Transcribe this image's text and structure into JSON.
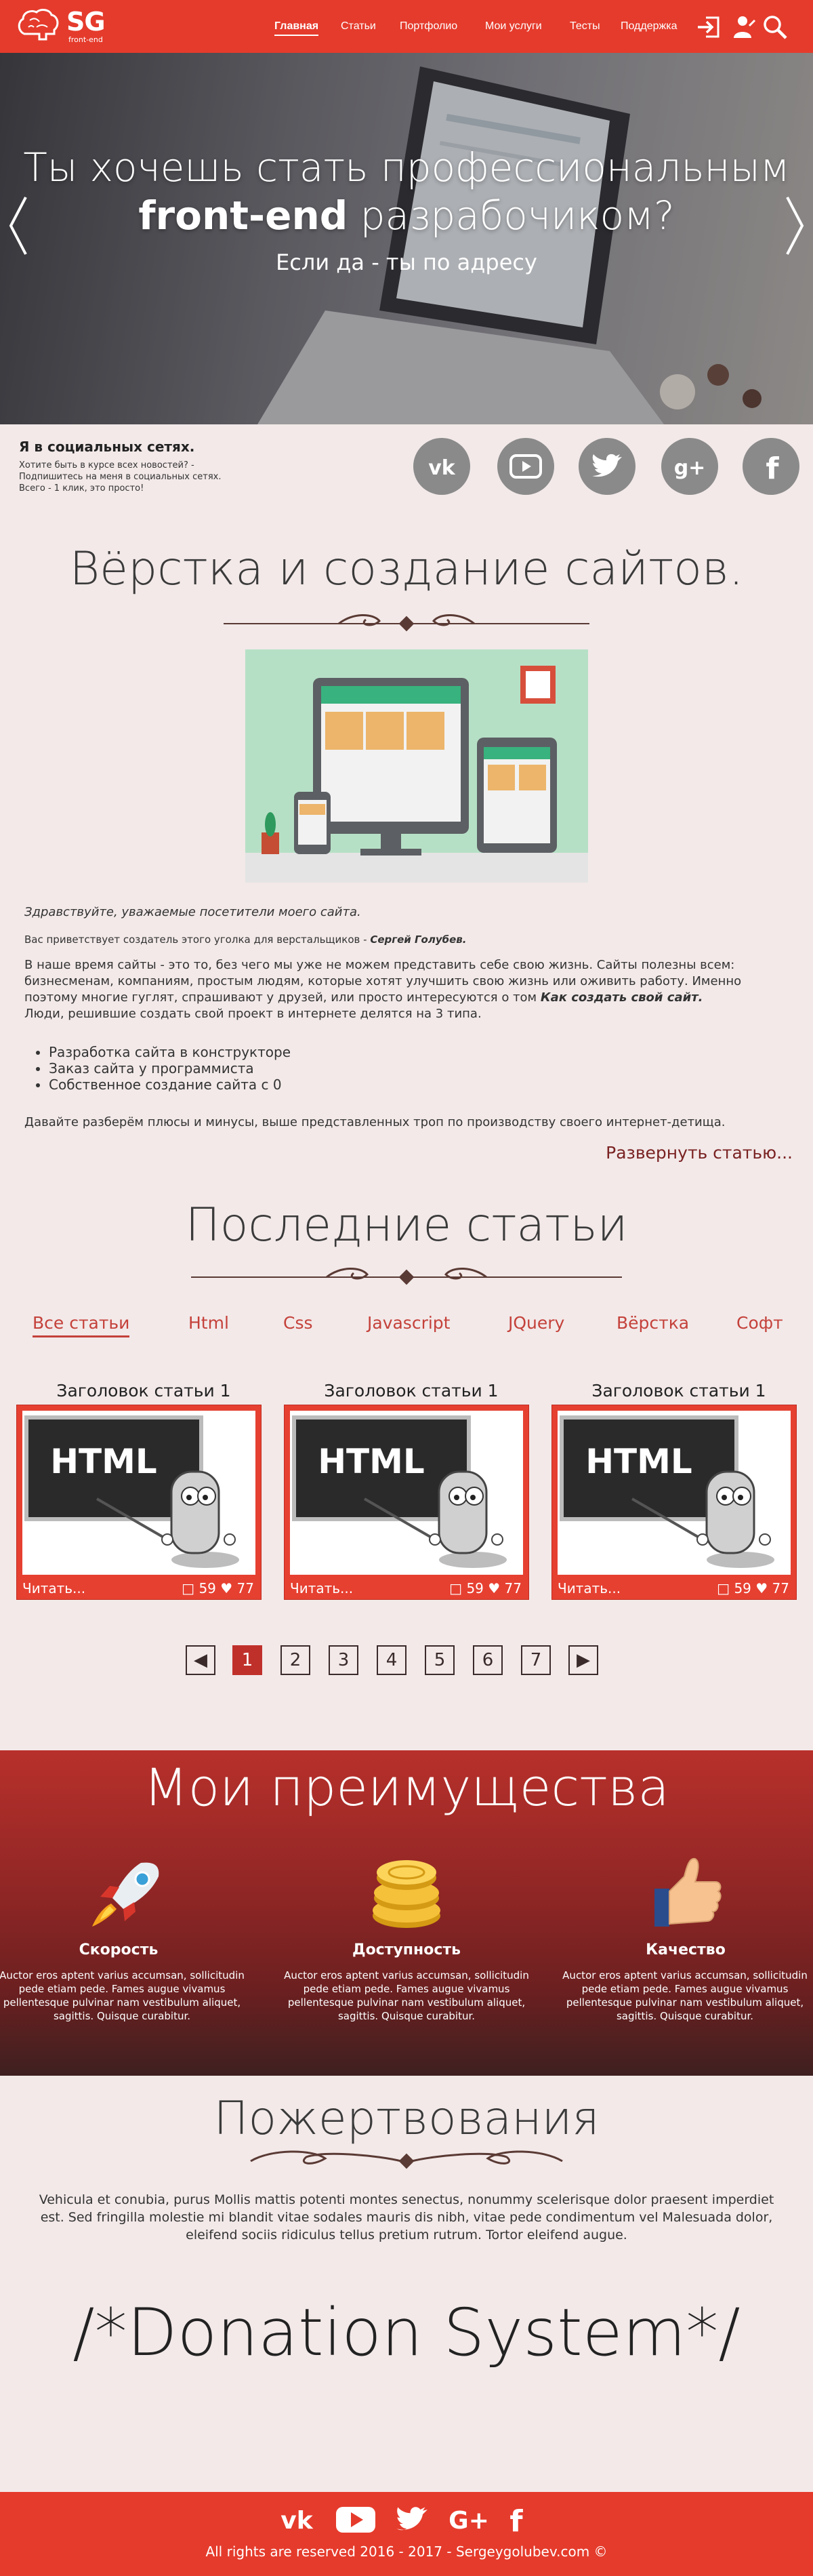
{
  "header": {
    "logo_text": "SG",
    "logo_sub": "front-end",
    "nav": [
      "Главная",
      "Статьи",
      "Портфолио",
      "Мои услуги",
      "Тесты",
      "Поддержка"
    ],
    "icons": [
      "login-icon",
      "user-icon",
      "search-icon"
    ]
  },
  "hero": {
    "line1": "Ты хочешь стать профессиональным",
    "line2_bold": "front-end",
    "line2_rest": " разрабочиком?",
    "sub": "Если да - ты по адресу"
  },
  "social": {
    "title": "Я в социальных сетях.",
    "text": [
      "Хотите быть в курсе всех новостей? -",
      "Подпишитесь на меня в  социальных сетях.",
      "Всего - 1 клик, это просто!"
    ],
    "icons": [
      "vk-icon",
      "youtube-icon",
      "twitter-icon",
      "googleplus-icon",
      "facebook-icon"
    ]
  },
  "intro": {
    "title": "Вёрстка и создание сайтов.",
    "greeting": "Здравствуйте, уважаемые посетители моего сайта.",
    "author_line": "Вас приветствует создатель этого уголка для верстальщиков - ",
    "author_name": "Сергей Голубев.",
    "para1": "В наше время сайты - это то, без чего мы уже не можем представить себе свою жизнь. Сайты полезны всем: бизнесменам, компаниям, простым людям, которые хотят улучшить свою жизнь или оживить работу. Именно поэтому  многие гуглят, спрашивают у друзей, или просто интересуются о том ",
    "para1_bold": "Как создать свой сайт.",
    "para2": " Люди, решившие создать свой проект в интернете делятся на 3 типа.",
    "list": [
      "Разработка сайта в конструкторе",
      "Заказ сайта у программиста",
      "Собственное создание сайта с 0"
    ],
    "para3": "Давайте разберём плюсы и минусы, выше представленных троп по производству своего интернет-детища.",
    "expand": "Развернуть статью..."
  },
  "articles": {
    "title": "Последние статьи",
    "tabs": [
      "Все статьи",
      "Html",
      "Css",
      "Javascript",
      "JQuery",
      "Вёрстка",
      "Софт"
    ],
    "cards": [
      {
        "title": "Заголовок статьи 1",
        "board": "HTML",
        "read": "Читать...",
        "comments": "59",
        "likes": "77"
      },
      {
        "title": "Заголовок статьи 1",
        "board": "HTML",
        "read": "Читать...",
        "comments": "59",
        "likes": "77"
      },
      {
        "title": "Заголовок статьи 1",
        "board": "HTML",
        "read": "Читать...",
        "comments": "59",
        "likes": "77"
      }
    ],
    "pages": [
      "1",
      "2",
      "3",
      "4",
      "5",
      "6",
      "7"
    ],
    "current_page": "1"
  },
  "advantages": {
    "title": "Мои преимущества",
    "items": [
      {
        "icon": "rocket-icon",
        "title": "Скорость",
        "text": "Auctor eros aptent varius accumsan, sollicitudin pede etiam pede. Fames augue vivamus pellentesque pulvinar nam vestibulum aliquet, sagittis. Quisque curabitur."
      },
      {
        "icon": "coins-icon",
        "title": "Доступность",
        "text": "Auctor eros aptent varius accumsan, sollicitudin pede etiam pede. Fames augue vivamus pellentesque pulvinar nam vestibulum aliquet, sagittis. Quisque curabitur."
      },
      {
        "icon": "thumbs-up-icon",
        "title": "Качество",
        "text": "Auctor eros aptent varius accumsan, sollicitudin pede etiam pede. Fames augue vivamus pellentesque pulvinar nam vestibulum aliquet, sagittis. Quisque curabitur."
      }
    ]
  },
  "donation": {
    "title": "Пожертвования",
    "text": "Vehicula et conubia, purus Mollis mattis potenti montes senectus, nonummy scelerisque dolor praesent imperdiet est. Sed fringilla molestie mi blandit vitae sodales mauris dis nibh, vitae pede condimentum vel Malesuada dolor, eleifend sociis ridiculus tellus pretium rutrum. Tortor eleifend augue.",
    "system": "/*Donation System*/"
  },
  "footer": {
    "icons": [
      "vk-icon",
      "youtube-icon",
      "twitter-icon",
      "googleplus-icon",
      "facebook-icon"
    ],
    "copyright": "All rights are reserved 2016 - 2017 - Sergeygolubev.com ©"
  },
  "colors": {
    "brand": "#e53b2c",
    "dark_red": "#7a2222",
    "tab_red": "#c4413a"
  }
}
